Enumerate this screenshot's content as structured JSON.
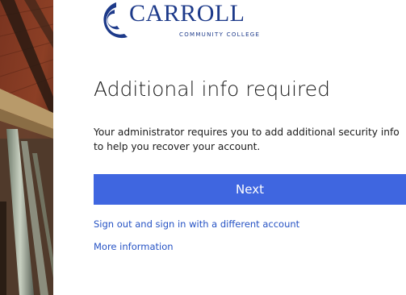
{
  "logo": {
    "name": "CARROLL",
    "subtitle": "COMMUNITY COLLEGE",
    "brand_color": "#1d3a8a"
  },
  "main": {
    "title": "Additional info required",
    "description": "Your administrator requires you to add additional security info to help you recover your account.",
    "next_label": "Next",
    "button_color": "#3f66e0"
  },
  "links": {
    "signout_label": "Sign out and sign in with a different account",
    "more_info_label": "More information",
    "link_color": "#2552c4"
  }
}
